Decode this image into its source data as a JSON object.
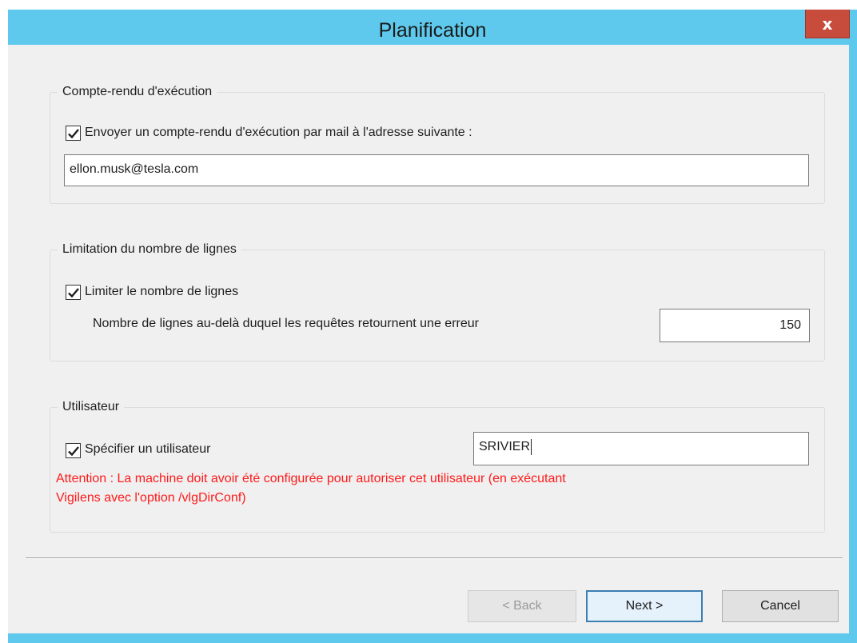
{
  "window": {
    "title": "Planification",
    "close_glyph": "x"
  },
  "report": {
    "legend": "Compte-rendu d'exécution",
    "checkbox_label": "Envoyer un compte-rendu d'exécution par mail à l'adresse suivante :",
    "checked": true,
    "email_value": "ellon.musk@tesla.com"
  },
  "limit": {
    "legend": "Limitation du nombre de lignes",
    "checkbox_label": "Limiter le nombre de lignes",
    "checked": true,
    "count_label": "Nombre de lignes au-delà duquel les requêtes retournent une erreur",
    "count_value": "150"
  },
  "user": {
    "legend": "Utilisateur",
    "checkbox_label": "Spécifier un utilisateur",
    "checked": true,
    "user_value": "SRIVIER",
    "warning_line1": "Attention : La machine doit avoir été configurée pour autoriser cet utilisateur (en exécutant",
    "warning_line2": "Vigilens avec l'option /vlgDirConf)"
  },
  "buttons": {
    "back_label": "< Back",
    "next_label": "Next >",
    "cancel_label": "Cancel"
  },
  "colors": {
    "titlebar": "#5ec9ec",
    "close": "#c74c3c",
    "warning": "#ff1a1a",
    "default_button_border": "#3c7fb1"
  }
}
